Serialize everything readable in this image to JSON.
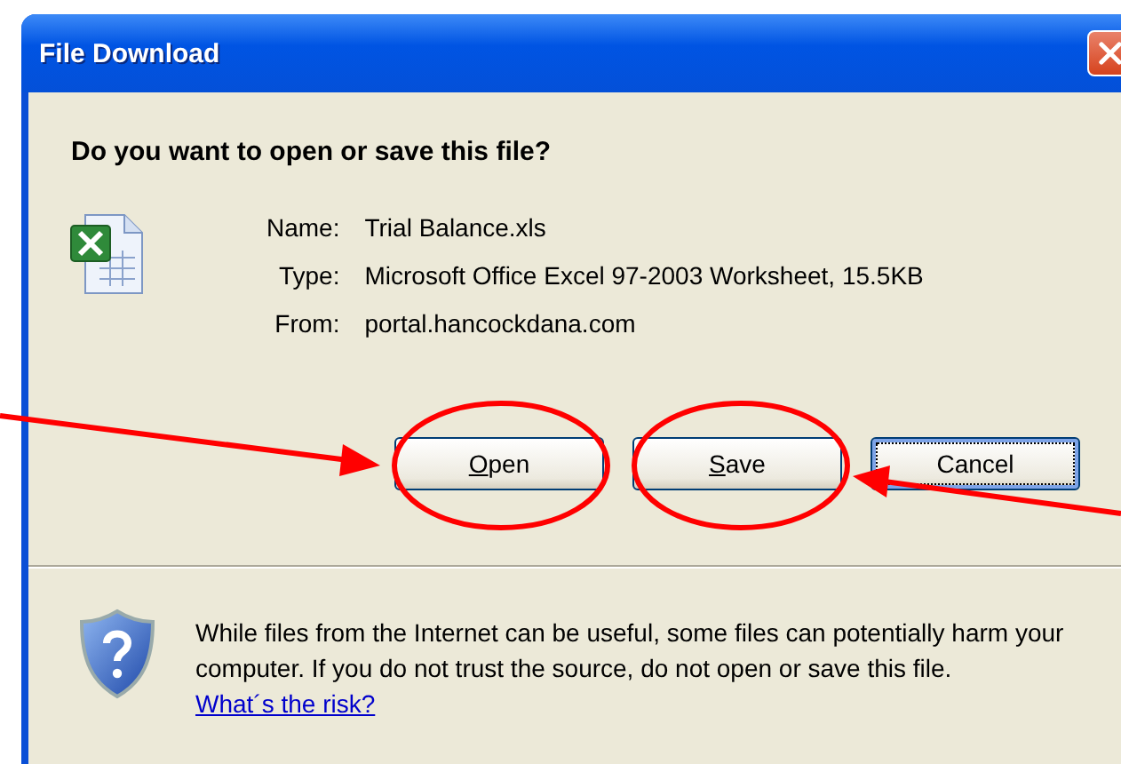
{
  "window": {
    "title": "File Download"
  },
  "question": "Do you want to open or save this file?",
  "file_info": [
    {
      "label": "Name:",
      "value": "Trial Balance.xls"
    },
    {
      "label": "Type:",
      "value": "Microsoft Office Excel 97-2003 Worksheet, 15.5KB"
    },
    {
      "label": "From:",
      "value": "portal.hancockdana.com"
    }
  ],
  "buttons": [
    {
      "label": "Open",
      "underline_first": true,
      "focused": false,
      "annotated": true
    },
    {
      "label": "Save",
      "underline_first": true,
      "focused": false,
      "annotated": true
    },
    {
      "label": "Cancel",
      "underline_first": false,
      "focused": true,
      "annotated": false
    }
  ],
  "warning": {
    "text": "While files from the Internet can be useful, some files can potentially harm your computer. If you do not trust the source, do not open or save this file.",
    "link": "What´s the risk?"
  }
}
